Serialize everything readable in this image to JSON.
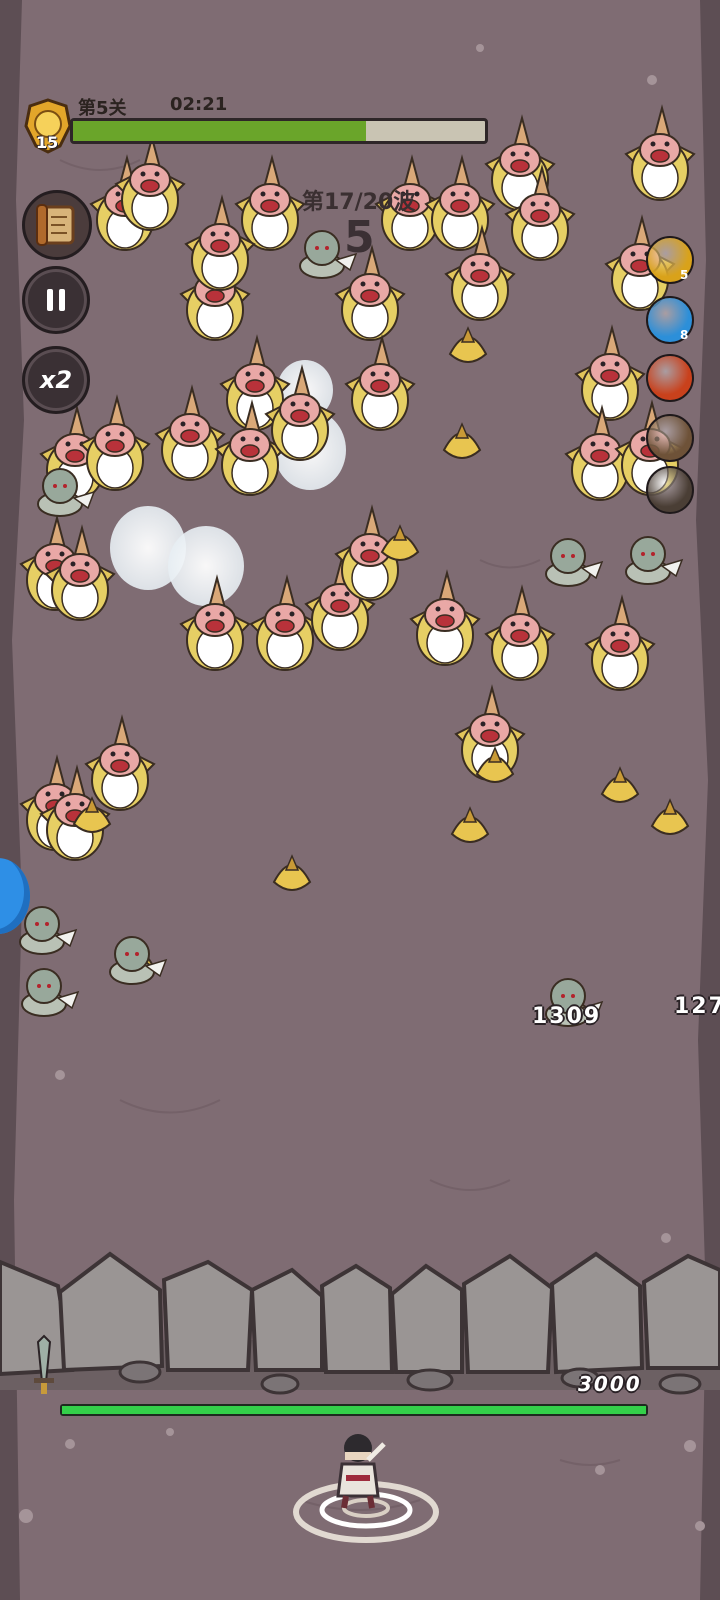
{
  "hud": {
    "level_badge": "15",
    "stage_label": "第5关",
    "timer": "02:21",
    "stage_progress": 0.71,
    "wave_label": "第17/20波",
    "countdown": "5"
  },
  "controls": {
    "speed_label": "x2"
  },
  "skills": [
    {
      "name": "lightning-skill",
      "count": "5",
      "color": "#d9a21a"
    },
    {
      "name": "frost-skill",
      "count": "8",
      "color": "#2c8fd9"
    },
    {
      "name": "fire-skill",
      "count": "",
      "color": "#c9411c"
    },
    {
      "name": "earth-skill",
      "count": "",
      "color": "#6e5238"
    },
    {
      "name": "locked-skill",
      "count": "",
      "color": "#4a3e35"
    }
  ],
  "damage_numbers": [
    "1309",
    "127"
  ],
  "wall": {
    "hp_value": "3000",
    "hp_ratio": 1.0
  },
  "colors": {
    "ground": "#7f6c73",
    "progress_fill": "#6aa52a",
    "hp_bar": "#34d04a"
  }
}
